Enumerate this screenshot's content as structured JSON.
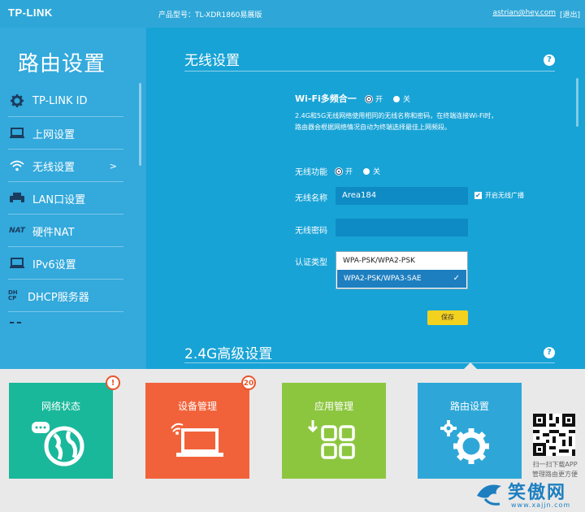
{
  "header": {
    "logo": "TP-LINK",
    "model_label": "产品型号：TL-XDR1860易展版",
    "user": "astrian@hey.com",
    "logout": "[退出]"
  },
  "sidebar": {
    "title": "路由设置",
    "items": [
      {
        "label": "TP-LINK ID",
        "icon": "gear-icon"
      },
      {
        "label": "上网设置",
        "icon": "monitor-icon"
      },
      {
        "label": "无线设置",
        "icon": "wifi-icon",
        "arrow": ">"
      },
      {
        "label": "LAN口设置",
        "icon": "printer-icon"
      },
      {
        "label": "硬件NAT",
        "icon": "nat-icon",
        "icon_text": "NAT"
      },
      {
        "label": "IPv6设置",
        "icon": "monitor-icon"
      },
      {
        "label": "DHCP服务器",
        "icon": "dhcp-icon",
        "icon_text": "DHCP"
      }
    ]
  },
  "wireless": {
    "section_title": "无线设置",
    "help": "?",
    "multiband_label": "Wi-Fi多频合一",
    "on": "开",
    "off": "关",
    "description_line1": "2.4G和5G无线网络使用相同的无线名称和密码，在终端连接Wi-Fi时，",
    "description_line2": "路由器会根据网络情况自动为终端选择最佳上网频段。",
    "function_label": "无线功能",
    "ssid_label": "无线名称",
    "ssid_value": "Area184",
    "broadcast_label": "开启无线广播",
    "password_label": "无线密码",
    "password_value": "",
    "auth_label": "认证类型",
    "auth_options": [
      "WPA-PSK/WPA2-PSK",
      "WPA2-PSK/WPA3-SAE"
    ],
    "auth_selected": "WPA2-PSK/WPA3-SAE",
    "save_button": "保存"
  },
  "advanced": {
    "section_title": "2.4G高级设置",
    "help": "?"
  },
  "tiles": [
    {
      "label": "网络状态",
      "badge": "!",
      "color": "#19b89b",
      "badge_color": "#e8562c",
      "icon": "globe-icon"
    },
    {
      "label": "设备管理",
      "badge": "20",
      "color": "#f2623a",
      "badge_color": "#e8562c",
      "icon": "laptop-icon"
    },
    {
      "label": "应用管理",
      "color": "#8cc63f",
      "icon": "apps-icon"
    },
    {
      "label": "路由设置",
      "color": "#2ea7d8",
      "icon": "gears-icon"
    }
  ],
  "app_promo": {
    "line1": "扫一扫下载APP",
    "line2": "管理路由更方便"
  },
  "watermark": {
    "text": "笑傲网",
    "url": "www.xajjn.com"
  }
}
